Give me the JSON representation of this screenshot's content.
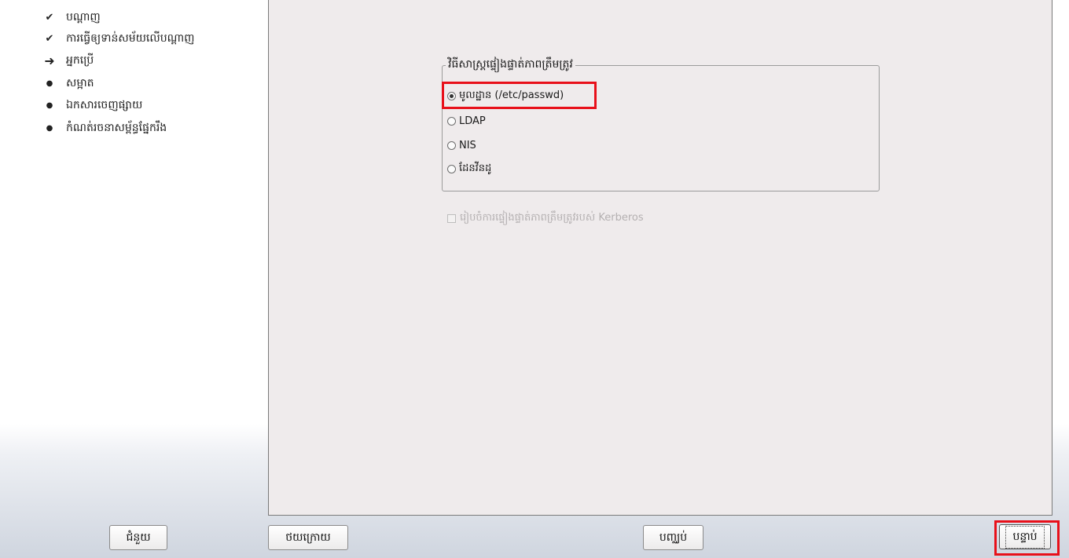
{
  "sidebar": {
    "steps": [
      {
        "label": "បណ្ដាញ",
        "status": "done",
        "mark": "✔"
      },
      {
        "label": "ការធ្វើឲ្យទាន់សម័យលើបណ្ដាញ",
        "status": "done",
        "mark": "✔"
      },
      {
        "label": "អ្នកប្រើ",
        "status": "current",
        "mark": "➜"
      },
      {
        "label": "សម្អាត",
        "status": "pending",
        "mark": "●"
      },
      {
        "label": "ឯកសារចេញផ្សាយ",
        "status": "pending",
        "mark": "●"
      },
      {
        "label": "កំណត់រចនាសម្ព័ន្ធផ្នែករឹង",
        "status": "pending",
        "mark": "●"
      }
    ]
  },
  "auth": {
    "group_title": "វិធីសាស្ត្រផ្ទៀងផ្ទាត់ភាពត្រឹមត្រូវ",
    "options": [
      {
        "label": "មូលដ្ឋាន (/etc/passwd)",
        "checked": true
      },
      {
        "label": "LDAP",
        "checked": false
      },
      {
        "label": "NIS",
        "checked": false
      },
      {
        "label": "ដែនវីនដូ",
        "checked": false
      }
    ],
    "kerberos_label": "រៀបចំការផ្ទៀងផ្ទាត់ភាពត្រឹមត្រូវរបស់ Kerberos",
    "kerberos_enabled": false
  },
  "buttons": {
    "help": "ជំនួយ",
    "back": "ថយក្រោយ",
    "cancel": "បញ្ឈប់",
    "next": "បន្ទាប់"
  },
  "colors": {
    "highlight": "#e8101a",
    "panel_bg": "#efebec",
    "disabled_text": "#b4b0b1"
  }
}
